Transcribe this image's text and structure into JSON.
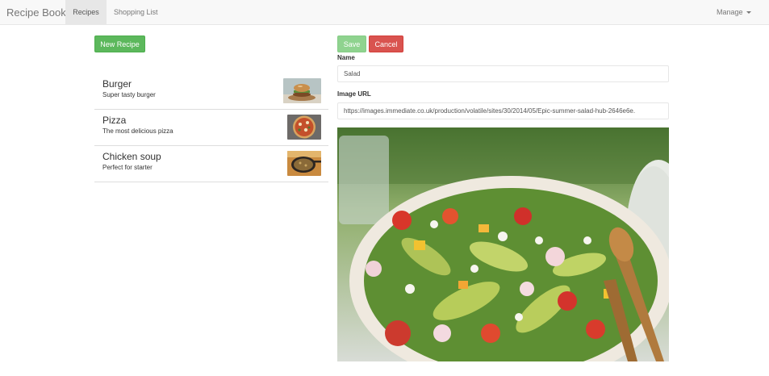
{
  "navbar": {
    "brand": "Recipe Book",
    "tabs": [
      {
        "label": "Recipes",
        "active": true
      },
      {
        "label": "Shopping List",
        "active": false
      }
    ],
    "manage_label": "Manage"
  },
  "recipes_panel": {
    "new_recipe_label": "New Recipe",
    "items": [
      {
        "name": "Burger",
        "description": "Super tasty burger",
        "image": "burger-photo"
      },
      {
        "name": "Pizza",
        "description": "The most delicious pizza",
        "image": "pizza-photo"
      },
      {
        "name": "Chicken soup",
        "description": "Perfect for starter",
        "image": "soup-photo"
      }
    ]
  },
  "edit_form": {
    "save_label": "Save",
    "cancel_label": "Cancel",
    "name_label": "Name",
    "name_value": "Salad",
    "image_url_label": "Image URL",
    "image_url_value": "https://images.immediate.co.uk/production/volatile/sites/30/2014/05/Epic-summer-salad-hub-2646e6e.",
    "preview_image": "salad-photo"
  },
  "colors": {
    "success": "#5cb85c",
    "danger": "#d9534f",
    "navbar_bg": "#f8f8f8"
  }
}
